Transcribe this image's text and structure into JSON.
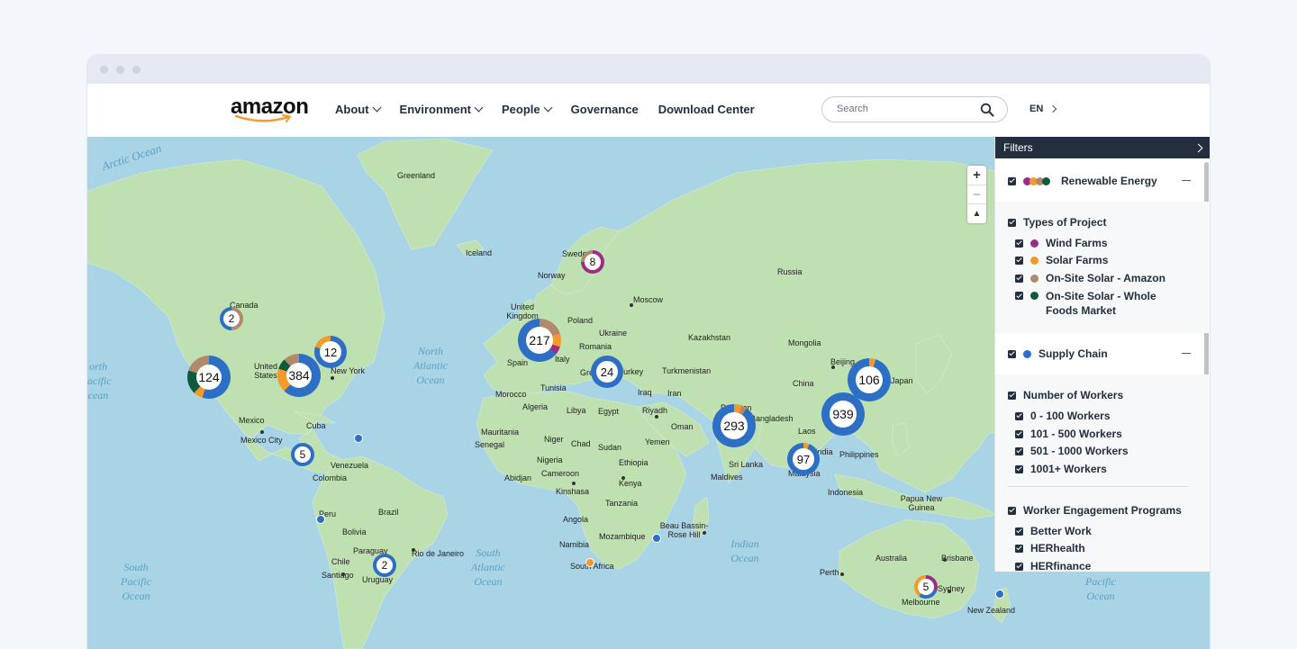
{
  "nav": {
    "logo": "amazon",
    "menu": [
      {
        "label": "About",
        "has_dropdown": true
      },
      {
        "label": "Environment",
        "has_dropdown": true
      },
      {
        "label": "People",
        "has_dropdown": true
      },
      {
        "label": "Governance",
        "has_dropdown": false
      },
      {
        "label": "Download Center",
        "has_dropdown": false
      }
    ],
    "search_placeholder": "Search",
    "language": "EN"
  },
  "map": {
    "oceans": [
      "Arctic Ocean",
      "North Atlantic Ocean",
      "South Atlantic Ocean",
      "Indian Ocean",
      "South Pacific Ocean",
      "Pacific Ocean",
      "orth acific cean"
    ],
    "places": [
      "Greenland",
      "Iceland",
      "Sweden",
      "Norway",
      "Russia",
      "Moscow",
      "Canada",
      "United Kingdom",
      "Poland",
      "Ukraine",
      "Romania",
      "Kazakhstan",
      "Mongolia",
      "Spain",
      "Italy",
      "Greece",
      "Turkey",
      "Turkmenistan",
      "Beijing",
      "Japan",
      "China",
      "Morocco",
      "Tunisia",
      "Iraq",
      "Iran",
      "United States",
      "New York",
      "Algeria",
      "Libya",
      "Egypt",
      "Riyadh",
      "Pakistan",
      "Bangladesh",
      "Mexico",
      "Mexico City",
      "Cuba",
      "Oman",
      "Mauritania",
      "Senegal",
      "Niger",
      "Chad",
      "Sudan",
      "Yemen",
      "Laos",
      "India",
      "Philippines",
      "Venezuela",
      "Colombia",
      "Nigeria",
      "Ethiopia",
      "Abidjan",
      "Cameroon",
      "Sri Lanka",
      "Maldives",
      "Malaysia",
      "Kenya",
      "Kinshasa",
      "Tanzania",
      "Indonesia",
      "Papua New Guinea",
      "Peru",
      "Brazil",
      "Bolivia",
      "Angola",
      "Beau Bassin-Rose Hill",
      "Mozambique",
      "Namibia",
      "Paraguay",
      "Rio de Janeiro",
      "South Africa",
      "Chile",
      "Santiago",
      "Uruguay",
      "Australia",
      "Brisbane",
      "Perth",
      "Sydney",
      "Melbourne",
      "New Zealand"
    ],
    "clusters": [
      {
        "count": "124"
      },
      {
        "count": "384"
      },
      {
        "count": "12"
      },
      {
        "count": "2"
      },
      {
        "count": "5"
      },
      {
        "count": "2"
      },
      {
        "count": "217"
      },
      {
        "count": "8"
      },
      {
        "count": "24"
      },
      {
        "count": "293"
      },
      {
        "count": "939"
      },
      {
        "count": "106"
      },
      {
        "count": "97"
      },
      {
        "count": "5"
      }
    ],
    "zoom": {
      "in": "+",
      "out": "−",
      "reset": "▲"
    }
  },
  "colors": {
    "wind": "#9b2d87",
    "solar": "#f39a2b",
    "onsite_amazon": "#b08a6a",
    "onsite_wholefoods": "#0e5a3c",
    "supply_chain": "#2e6fc6",
    "nav_dark": "#232f3e"
  },
  "filters": {
    "title": "Filters",
    "renewable": {
      "label": "Renewable Energy",
      "types_heading": "Types of Project",
      "types": [
        "Wind Farms",
        "Solar Farms",
        "On-Site Solar - Amazon",
        "On-Site Solar - Whole Foods Market"
      ]
    },
    "supply_chain": {
      "label": "Supply Chain",
      "workers_heading": "Number of Workers",
      "workers": [
        "0 - 100 Workers",
        "101 - 500 Workers",
        "501 - 1000 Workers",
        "1001+ Workers"
      ],
      "programs_heading": "Worker Engagement Programs",
      "programs": [
        "Better Work",
        "HERhealth",
        "HERfinance"
      ]
    }
  }
}
